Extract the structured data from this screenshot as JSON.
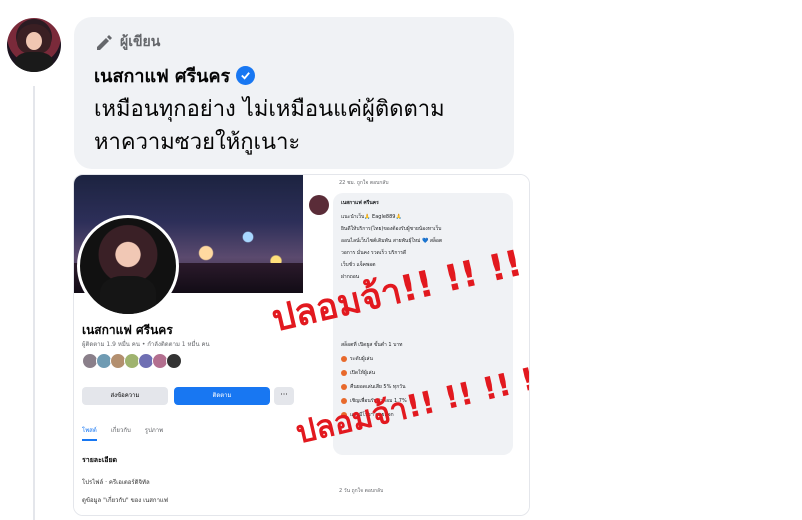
{
  "comment": {
    "author_badge": "ผู้เขียน",
    "author_name": "เนสกาแฟ ศรีนคร",
    "text": "เหมือนทุกอย่าง ไม่เหมือนแค่ผู้ติดตาม หาความซวยให้กูเนาะ"
  },
  "attachment": {
    "left_profile": {
      "name": "เนสกาแฟ ศรีนคร",
      "meta": "ผู้ติดตาม 1.9 หมื่น คน  •  กำลังติดตาม 1 หมื่น คน",
      "message_button": "ส่งข้อความ",
      "follow_button": "ติดตาม",
      "more_button": "···",
      "tabs": [
        "โพสต์",
        "เกี่ยวกับ",
        "รูปภาพ"
      ],
      "details_title": "รายละเอียด",
      "details_lines": [
        "โปรไฟล์ · ครีเอเตอร์ดิจิทัล",
        "ดูข้อมูล \"เกี่ยวกับ\" ของ เนสกาแฟ"
      ]
    },
    "right_post": {
      "time_actions": "22 ชม.   ถูกใจ   ตอบกลับ",
      "author": "เนสกาแฟ ศรีนคร",
      "lines": [
        "แนะนำเว็บ🙏 Eagle889🙏",
        "ยินดีให้บริการ(ไทย)ของต้องรับผู้ชายน้องหาเว็บ",
        "ออนไลน์เว็บไซต์เดิมพัน สายพันธุ์ใหม่ 💙 สล็อต",
        "วอการ มั่นคง รวดเร็ว บริการดี",
        "เว็บชั่ว แจ็คพอต",
        "ฝากถอน"
      ],
      "items": [
        "ระดับผู้เล่น",
        "เปิดให้ผู้เล่น",
        "คืนยอดเล่นเสีย 5% ทุกวัน",
        "เชิญเพื่อนรับค่าคอม 1.7%",
        "และมีโปรฯ คอยแจก"
      ],
      "sub_line": "สล็อตที่ เปิดยูส ขั้นต่ำ 1 บาท",
      "bottom": "2 วัน   ถูกใจ   ตอบกลับ"
    },
    "stamp_text": "ปลอมจ้า!! !! !! !!"
  }
}
